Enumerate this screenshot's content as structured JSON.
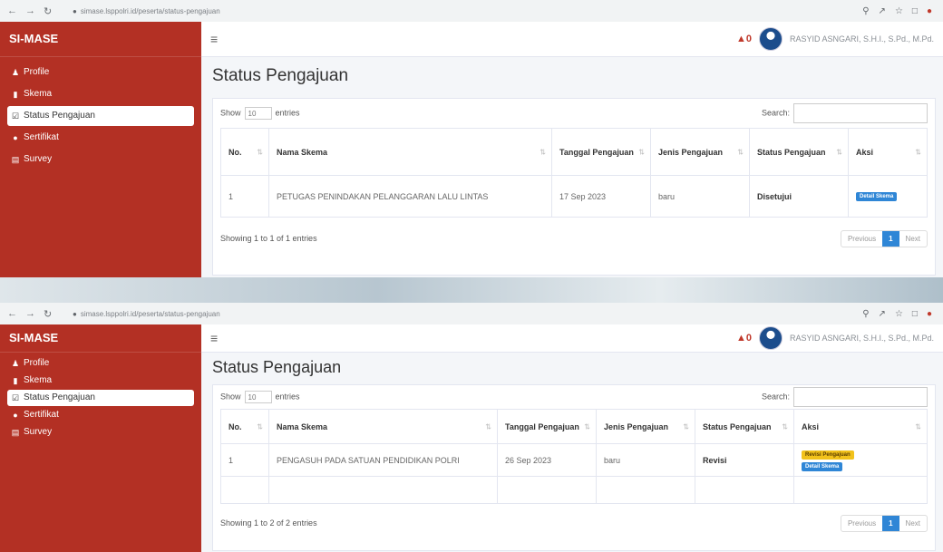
{
  "screens": [
    {
      "browser": {
        "url": "simase.lsppolri.id/peserta/status-pengajuan"
      },
      "brand": "SI-MASE",
      "menu": [
        {
          "label": "Profile",
          "icon": "user-icon"
        },
        {
          "label": "Skema",
          "icon": "file-icon"
        },
        {
          "label": "Status Pengajuan",
          "icon": "checkbox-icon",
          "active": true
        },
        {
          "label": "Sertifikat",
          "icon": "certificate-icon"
        },
        {
          "label": "Survey",
          "icon": "list-icon"
        }
      ],
      "user_name": "RASYID ASNGARI, S.H.I., S.Pd., M.Pd.",
      "title": "Status Pengajuan",
      "show_label": "Show",
      "entries_value": "10",
      "entries_label": "entries",
      "search_label": "Search:",
      "columns": [
        "No.",
        "Nama Skema",
        "Tanggal Pengajuan",
        "Jenis Pengajuan",
        "Status Pengajuan",
        "Aksi"
      ],
      "rows": [
        {
          "no": "1",
          "nama": "PETUGAS PENINDAKAN PELANGGARAN LALU LINTAS",
          "tanggal": "17 Sep 2023",
          "jenis": "baru",
          "status": "Disetujui",
          "actions": [
            "Detail Skema"
          ]
        }
      ],
      "showing": "Showing 1 to 1 of 1 entries",
      "pager": {
        "prev": "Previous",
        "page": "1",
        "next": "Next"
      }
    },
    {
      "browser": {
        "url": "simase.lsppolri.id/peserta/status-pengajuan"
      },
      "brand": "SI-MASE",
      "menu": [
        {
          "label": "Profile",
          "icon": "user-icon"
        },
        {
          "label": "Skema",
          "icon": "file-icon"
        },
        {
          "label": "Status Pengajuan",
          "icon": "checkbox-icon",
          "active": true
        },
        {
          "label": "Sertifikat",
          "icon": "certificate-icon"
        },
        {
          "label": "Survey",
          "icon": "list-icon"
        }
      ],
      "user_name": "RASYID ASNGARI, S.H.I., S.Pd., M.Pd.",
      "title": "Status Pengajuan",
      "show_label": "Show",
      "entries_value": "10",
      "entries_label": "entries",
      "search_label": "Search:",
      "columns": [
        "No.",
        "Nama Skema",
        "Tanggal Pengajuan",
        "Jenis Pengajuan",
        "Status Pengajuan",
        "Aksi"
      ],
      "rows": [
        {
          "no": "1",
          "nama": "PENGASUH PADA SATUAN PENDIDIKAN POLRI",
          "tanggal": "26 Sep 2023",
          "jenis": "baru",
          "status": "Revisi",
          "actions": [
            "Revisi Pengajuan",
            "Detail Skema"
          ]
        }
      ],
      "showing": "Showing 1 to 2 of 2 entries",
      "pager": {
        "prev": "Previous",
        "page": "1",
        "next": "Next"
      }
    }
  ]
}
